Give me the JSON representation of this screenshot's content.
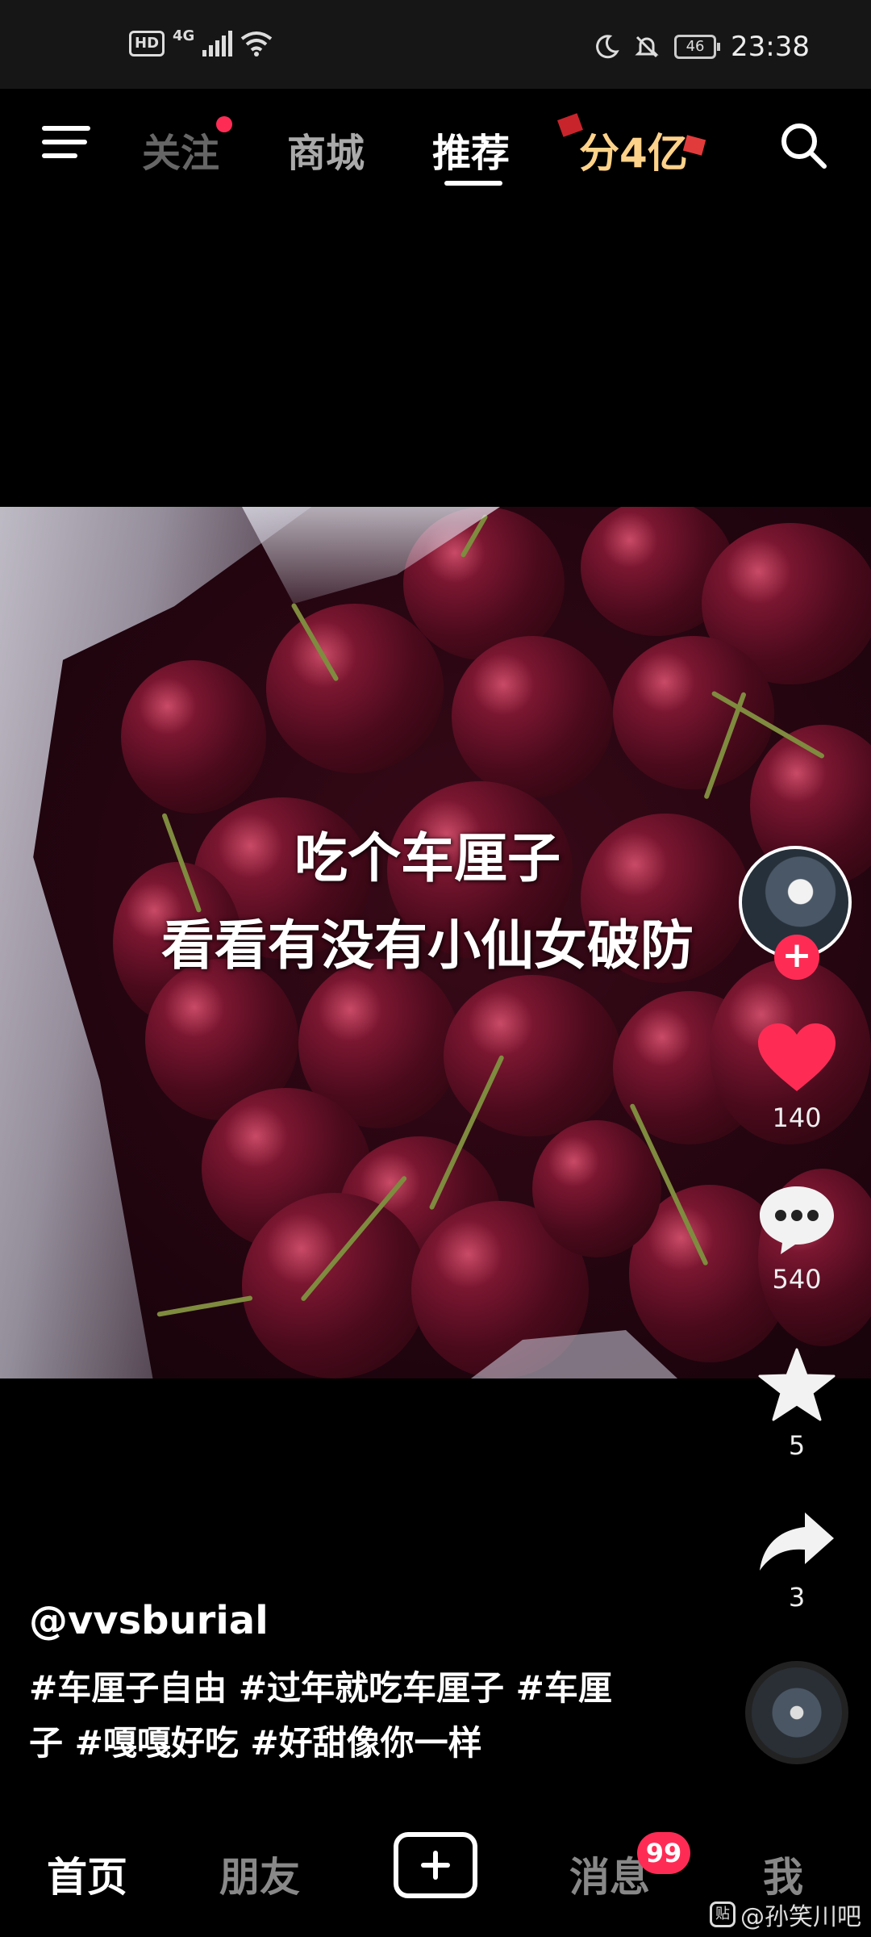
{
  "status_bar": {
    "hd": "HD",
    "network": "4G",
    "battery": "46",
    "time": "23:38"
  },
  "top_nav": {
    "tabs": [
      {
        "label": "关注",
        "has_dot": true
      },
      {
        "label": "商城"
      },
      {
        "label": "推荐",
        "active": true
      },
      {
        "label": "分4亿"
      }
    ],
    "icons": [
      "menu-icon",
      "search-icon"
    ]
  },
  "video": {
    "overlay_line1": "吃个车厘子",
    "overlay_line2": "看看有没有小仙女破防"
  },
  "actions": {
    "likes": "140",
    "comments": "540",
    "favorites": "5",
    "shares": "3",
    "follow_symbol": "+"
  },
  "caption": {
    "username": "@vvsburial",
    "hashtags": "#车厘子自由 #过年就吃车厘子 #车厘子 #嘎嘎好吃 #好甜像你一样"
  },
  "bottom_nav": {
    "items": [
      "首页",
      "朋友",
      "消息",
      "我"
    ],
    "message_badge": "99"
  },
  "watermark": {
    "icon": "贴",
    "text": "@孙笑川吧"
  },
  "colors": {
    "accent": "#fe2c55",
    "background": "#000000",
    "promo": "#ffd28a"
  }
}
